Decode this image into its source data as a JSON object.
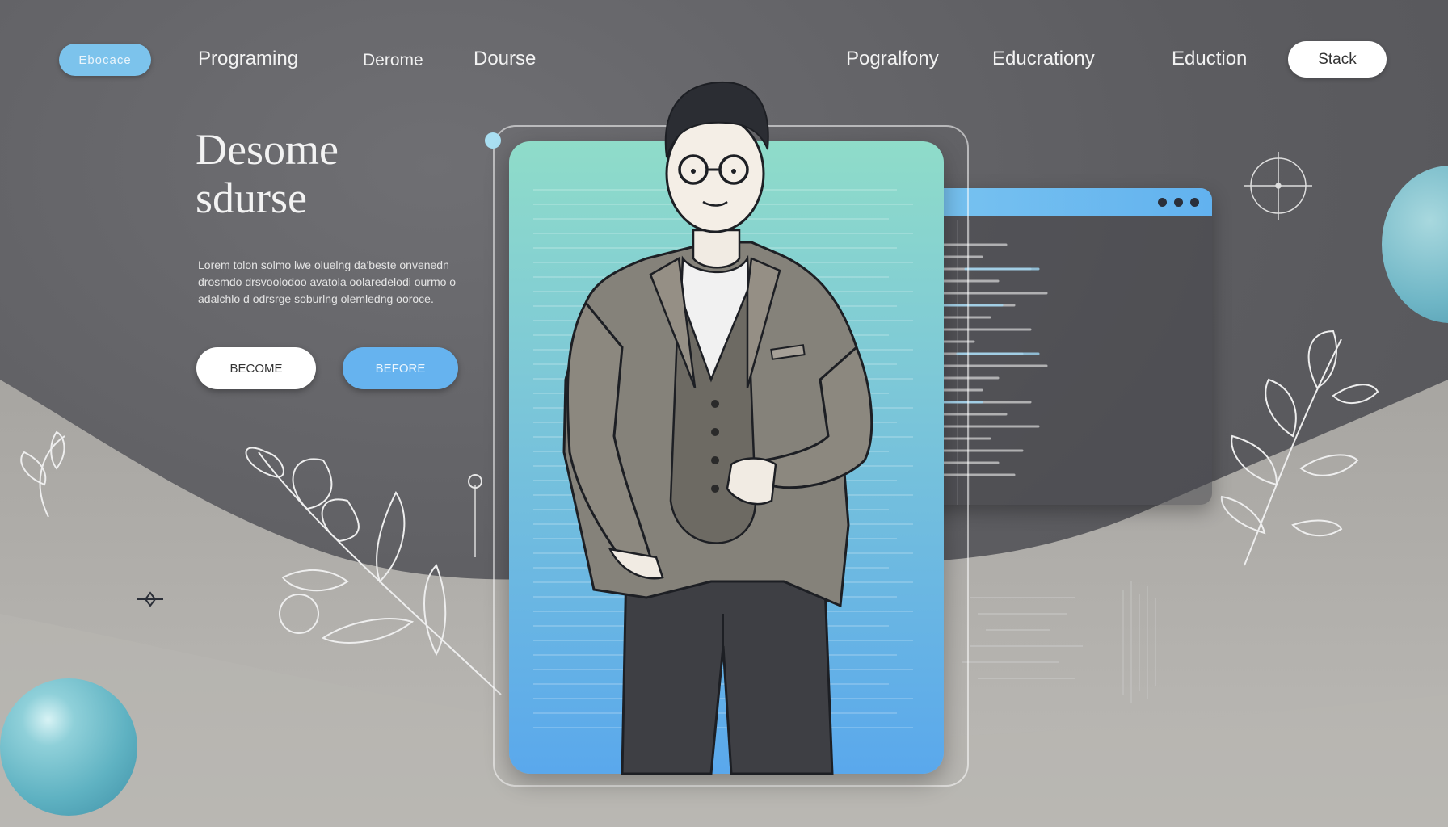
{
  "nav": {
    "logo": "Ebocace",
    "links_left": [
      "Programing",
      "Derome",
      "Dourse"
    ],
    "links_right": [
      "Pogralfony",
      "Educrationy",
      "Eduction"
    ],
    "cta": "Stack"
  },
  "hero": {
    "title": "Desome\nsdurse",
    "body": "Lorem tolon solmo lwe oluelng da'beste onvenedn drosmdo drsvoolodoo avatola oolaredelodi ourmo o adalchlo d odrsrge soburlng olemledng ooroce.",
    "primary_button": "BECOME",
    "secondary_button": "BEFORE"
  },
  "colors": {
    "accent_blue": "#66b3ef",
    "panel_teal": "#8fdcc9",
    "background": "#5c5c60"
  },
  "icons": [
    "crosshair-icon",
    "diamond-icon",
    "leaf-icon"
  ]
}
